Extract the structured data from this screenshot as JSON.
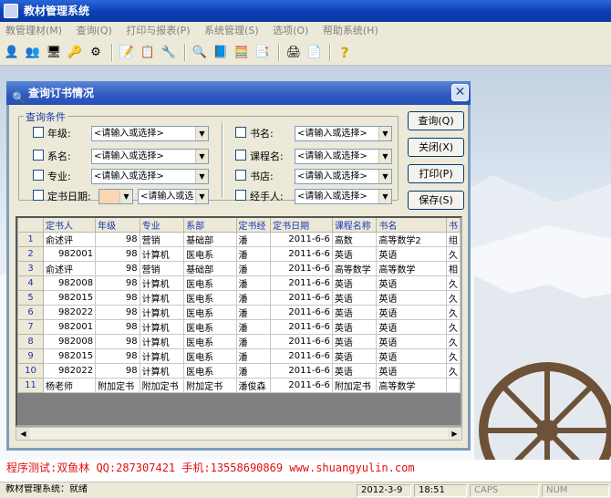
{
  "app": {
    "title": "教材管理系统"
  },
  "menu": [
    {
      "label": "教管理材(M)"
    },
    {
      "label": "查询(Q)"
    },
    {
      "label": "打印与报表(P)"
    },
    {
      "label": "系统管理(S)"
    },
    {
      "label": "选项(O)"
    },
    {
      "label": "帮助系统(H)"
    }
  ],
  "toolbar": [
    "user-icon",
    "users-icon",
    "computer-icon",
    "key-icon",
    "settings-icon",
    "edit-form-icon",
    "list-form-icon",
    "tools-icon",
    "search-icon",
    "book-icon",
    "calculator-icon",
    "report-icon",
    "printer-icon",
    "print-preview-icon",
    "help-icon"
  ],
  "dialog": {
    "title": "查询订书情况",
    "close_glyph": "✕",
    "group_label": "查询条件",
    "placeholder": "<请输入或选择>",
    "placeholder_short": "<请输入或选",
    "fields_left": [
      {
        "label": "年级:",
        "value": "<请输入或选择>"
      },
      {
        "label": "系名:",
        "value": "<请输入或选择>"
      },
      {
        "label": "专业:",
        "value": "<请输入或选择>"
      },
      {
        "label": "定书日期:",
        "value": "<请输入或选"
      }
    ],
    "fields_right": [
      {
        "label": "书名:",
        "value": "<请输入或选择>"
      },
      {
        "label": "课程名:",
        "value": "<请输入或选择>"
      },
      {
        "label": "书店:",
        "value": "<请输入或选择>"
      },
      {
        "label": "经手人:",
        "value": "<请输入或选择>"
      }
    ],
    "buttons": {
      "query": "查询(Q)",
      "close": "关闭(X)",
      "print": "打印(P)",
      "save": "保存(S)"
    },
    "grid": {
      "columns": [
        "定书人",
        "年级",
        "专业",
        "系部",
        "定书经",
        "定书日期",
        "课程名称",
        "书名",
        "书"
      ],
      "rows": [
        [
          "1",
          "俞述评",
          "98",
          "营销",
          "基础部",
          "潘",
          "2011-6-6",
          "高数",
          "高等数学2",
          "组"
        ],
        [
          "2",
          "982001",
          "98",
          "计算机",
          "医电系",
          "潘",
          "2011-6-6",
          "英语",
          "英语",
          "久"
        ],
        [
          "3",
          "俞述评",
          "98",
          "营销",
          "基础部",
          "潘",
          "2011-6-6",
          "高等数学",
          "高等数学",
          "相"
        ],
        [
          "4",
          "982008",
          "98",
          "计算机",
          "医电系",
          "潘",
          "2011-6-6",
          "英语",
          "英语",
          "久"
        ],
        [
          "5",
          "982015",
          "98",
          "计算机",
          "医电系",
          "潘",
          "2011-6-6",
          "英语",
          "英语",
          "久"
        ],
        [
          "6",
          "982022",
          "98",
          "计算机",
          "医电系",
          "潘",
          "2011-6-6",
          "英语",
          "英语",
          "久"
        ],
        [
          "7",
          "982001",
          "98",
          "计算机",
          "医电系",
          "潘",
          "2011-6-6",
          "英语",
          "英语",
          "久"
        ],
        [
          "8",
          "982008",
          "98",
          "计算机",
          "医电系",
          "潘",
          "2011-6-6",
          "英语",
          "英语",
          "久"
        ],
        [
          "9",
          "982015",
          "98",
          "计算机",
          "医电系",
          "潘",
          "2011-6-6",
          "英语",
          "英语",
          "久"
        ],
        [
          "10",
          "982022",
          "98",
          "计算机",
          "医电系",
          "潘",
          "2011-6-6",
          "英语",
          "英语",
          "久"
        ],
        [
          "11",
          "杨老师",
          "附加定书",
          "附加定书",
          "附加定书",
          "潘俊森",
          "2011-6-6",
          "附加定书",
          "高等数学",
          ""
        ]
      ]
    }
  },
  "credit": "程序测试:双鱼林 QQ:287307421 手机:13558690869 www.shuangyulin.com",
  "status": {
    "text": "教材管理系统：就绪",
    "date": "2012-3-9",
    "time": "18:51",
    "caps": "CAPS",
    "num": "NUM"
  },
  "colors": {
    "titlebar": "#0a3fb4",
    "dialog_title": "#2d59c0",
    "credit": "#e01010",
    "grid_header_text": "#1a36b6"
  }
}
